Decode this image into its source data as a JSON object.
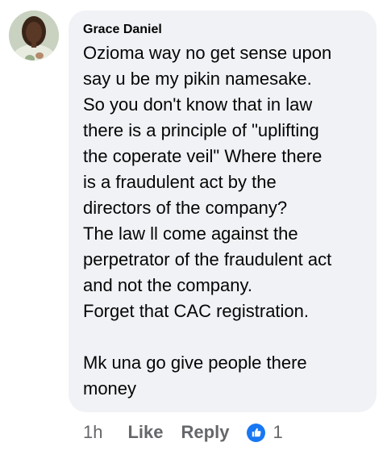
{
  "comment": {
    "author": "Grace Daniel",
    "text": "Ozioma way no get sense upon\nsay u be my pikin namesake.\nSo you don't know that in law\nthere is a principle of \"uplifting\nthe coperate veil\" Where there\nis a fraudulent act by the\ndirectors of the company?\nThe law ll come against the\nperpetrator of the fraudulent act\nand not the company.\nForget that CAC registration.\n\nMk una go give people there\nmoney",
    "timestamp": "1h",
    "like_label": "Like",
    "reply_label": "Reply",
    "reaction_count": "1",
    "reaction_icon": "thumbs-up-icon"
  },
  "colors": {
    "bubble": "#f0f2f5",
    "meta_text": "#65676b",
    "like_blue": "#1877f2"
  }
}
